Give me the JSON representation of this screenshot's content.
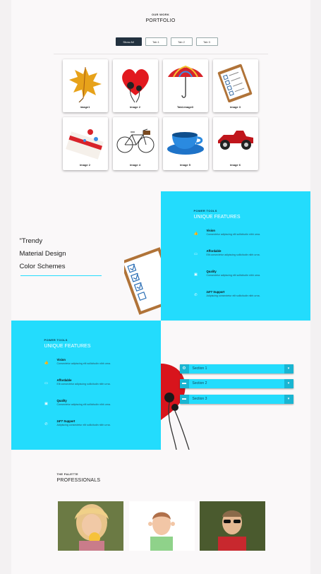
{
  "portfolio": {
    "eyebrow": "OUR WORK",
    "title": "PORTFOLIO",
    "tabs": [
      {
        "label": "Show All",
        "active": true
      },
      {
        "label": "Tab 1",
        "active": false
      },
      {
        "label": "Tab 2",
        "active": false
      },
      {
        "label": "Tab 3",
        "active": false
      }
    ],
    "items": [
      {
        "caption": "image1",
        "icon": "autumn-leaf-image"
      },
      {
        "caption": "image 2",
        "icon": "heart-earphones-image"
      },
      {
        "caption": "Tabl-image3",
        "icon": "umbrella-image"
      },
      {
        "caption": "image 3",
        "icon": "checklist-clipboard-image"
      },
      {
        "caption": "image 2",
        "icon": "envelope-pins-image"
      },
      {
        "caption": "image 4",
        "icon": "bicycle-image"
      },
      {
        "caption": "image 5",
        "icon": "teacup-image"
      },
      {
        "caption": "image 6",
        "icon": "vintage-car-image"
      }
    ]
  },
  "promo": {
    "line1": "\"Trendy",
    "line2": "Material Design",
    "line3": "Color Schemes"
  },
  "features_right": {
    "eyebrow": "POWER TOOLS",
    "title": "UNIQUE FEATURES",
    "items": [
      {
        "title": "Vision",
        "desc": "Consectetur adipiscing elit sollicitudin nibh urna."
      },
      {
        "title": "Affordable",
        "desc": "Elit consectetur adipiscing sollicitudin nibh urna."
      },
      {
        "title": "Quality",
        "desc": "Consectetur adipiscing elit sollicitudin nibh urna."
      },
      {
        "title": "24*7 Support",
        "desc": "Adipiscing consectetur elit sollicitudin nibh urna."
      }
    ]
  },
  "features_left": {
    "eyebrow": "POWER TOOLS",
    "title": "UNIQUE FEATURES",
    "items": [
      {
        "title": "Vision",
        "desc": "Consectetur adipiscing elit sollicitudin nibh urna."
      },
      {
        "title": "Affordable",
        "desc": "Elit consectetur adipiscing sollicitudin nibh urna."
      },
      {
        "title": "Quality",
        "desc": "Consectetur adipiscing elit sollicitudin nibh urna."
      },
      {
        "title": "24*7 Support",
        "desc": "Adipiscing consectetur elit sollicitudin nibh urna."
      }
    ]
  },
  "accordion": [
    {
      "label": "Section 1",
      "icon": "gear-icon"
    },
    {
      "label": "Section 2",
      "icon": "folder-icon"
    },
    {
      "label": "Section 3",
      "icon": "folder-icon"
    }
  ],
  "palette": {
    "eyebrow": "THE PALETTE",
    "title": "PROFESSIONALS"
  },
  "colors": {
    "accent": "#23dcfd",
    "dark": "#22313f"
  }
}
